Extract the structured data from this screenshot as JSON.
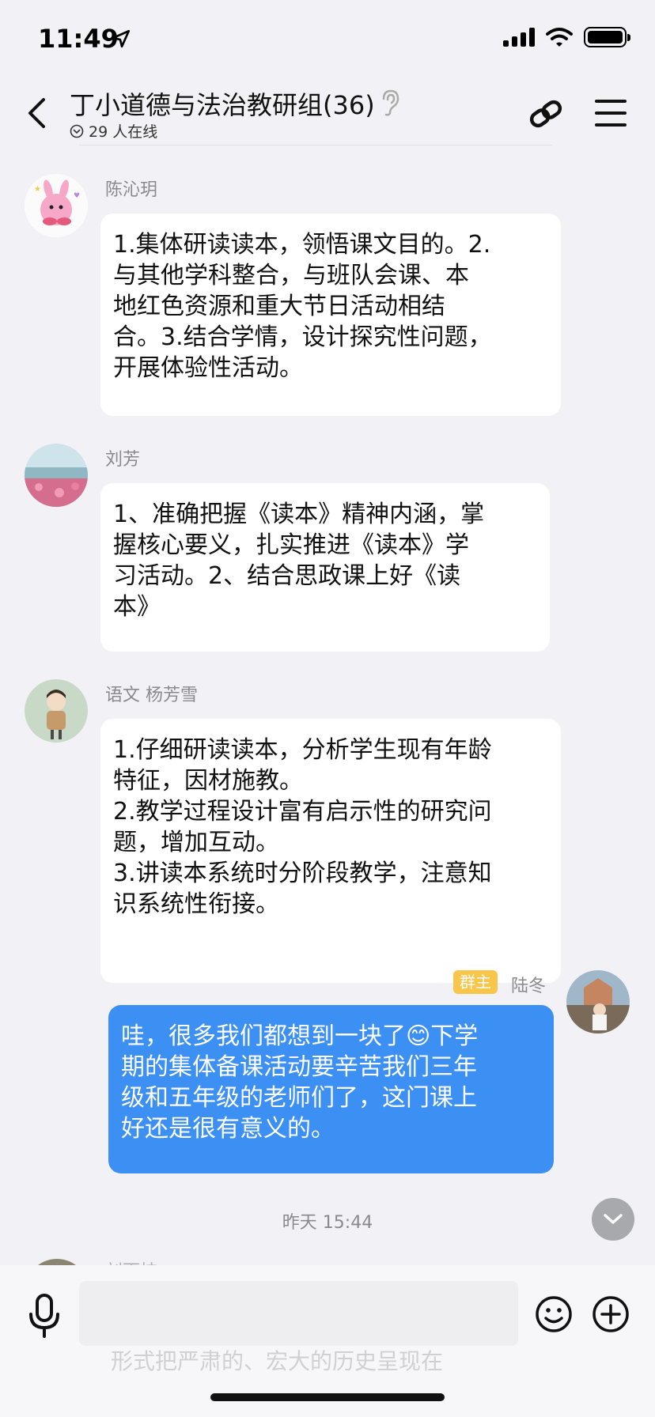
{
  "status_bar": {
    "time": "11:49"
  },
  "header": {
    "title": "丁小道德与法治教研组(36)",
    "online": "29 人在线"
  },
  "messages": [
    {
      "sender": "陈沁玥",
      "text": "1.集体研读读本，领悟课文目的。2.\n与其他学科整合，与班队会课、本\n地红色资源和重大节日活动相结\n合。3.结合学情，设计探究性问题，\n开展体验性活动。"
    },
    {
      "sender": "刘芳",
      "text": "1、准确把握《读本》精神内涵，掌\n握核心要义，扎实推进《读本》学\n习活动。2、结合思政课上好《读\n本》"
    },
    {
      "sender": "语文 杨芳雪",
      "text": "1.仔细研读读本，分析学生现有年龄\n特征，因材施教。\n2.教学过程设计富有启示性的研究问\n题，增加互动。\n3.讲读本系统时分阶段教学，注意知\n识系统性衔接。"
    },
    {
      "sender": "陆冬",
      "badge": "群主",
      "text_before": "哇，很多我们都想到一块了",
      "emoji": "😊",
      "text_after": "下学\n期的集体备课活动要辛苦我们三年\n级和五年级的老师们了，这门课上\n好还是很有意义的。"
    }
  ],
  "timestamp": "昨天 15:44",
  "next_message": {
    "sender_partial": "刘雨桔",
    "text_partial": "形式把严肃的、宏大的历史呈现在"
  },
  "icons": {
    "back": "chevron-left-icon",
    "ear": "ear-icon",
    "link": "link-icon",
    "menu": "menu-icon",
    "mic": "microphone-icon",
    "emoji": "smile-icon",
    "plus": "plus-circle-icon",
    "scroll": "chevron-down-icon"
  },
  "colors": {
    "background": "#f2f2f6",
    "my_bubble": "#3c8ff3",
    "owner_badge": "#f7c64a",
    "meta_text": "#8a8a8e"
  }
}
